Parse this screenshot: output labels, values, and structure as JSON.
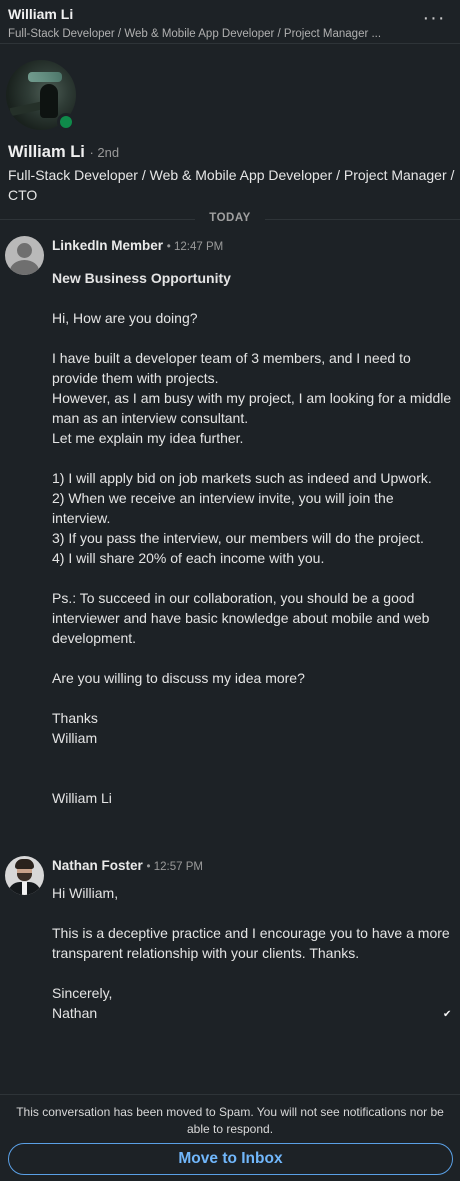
{
  "header": {
    "name": "William Li",
    "subtitle": "Full-Stack Developer / Web & Mobile App Developer / Project Manager ...",
    "more_icon": "more-horizontal-icon"
  },
  "profile": {
    "name": "William Li",
    "degree": "· 2nd",
    "headline": "Full-Stack Developer / Web & Mobile App Developer / Project Manager / CTO",
    "status_color": "#0f8a4a"
  },
  "day_separator": "TODAY",
  "messages": [
    {
      "sender": "LinkedIn Member",
      "time": "• 12:47 PM",
      "subject": "New Business Opportunity",
      "paragraphs": [
        "Hi, How are you doing?",
        "I have built a developer team of 3 members, and I need to provide them with projects.",
        "However, as I am busy with my project, I am looking for a middle man as an interview consultant.",
        "Let me explain my idea further.",
        "1) I will apply bid on job markets such as indeed and Upwork.",
        "2) When we receive an interview invite, you will join the interview.",
        "3) If you pass the interview, our members will do the project.",
        "4) I will share 20% of each income with you.",
        "Ps.: To succeed in our collaboration, you should be a good interviewer and have basic knowledge about mobile and web development.",
        "Are you willing to discuss my idea more?",
        "Thanks",
        "William",
        "William Li"
      ]
    },
    {
      "sender": "Nathan Foster",
      "time": "• 12:57 PM",
      "paragraphs": [
        "Hi William,",
        "This is a deceptive practice and I encourage you to have a more transparent relationship with your clients. Thanks.",
        "Sincerely,",
        "Nathan"
      ],
      "read_receipt": "✔"
    }
  ],
  "footer": {
    "notice": "This conversation has been moved to Spam. You will not see notifications nor be able to respond.",
    "button_label": "Move to Inbox"
  },
  "colors": {
    "background": "#1d2226",
    "accent": "#71b7fb"
  }
}
